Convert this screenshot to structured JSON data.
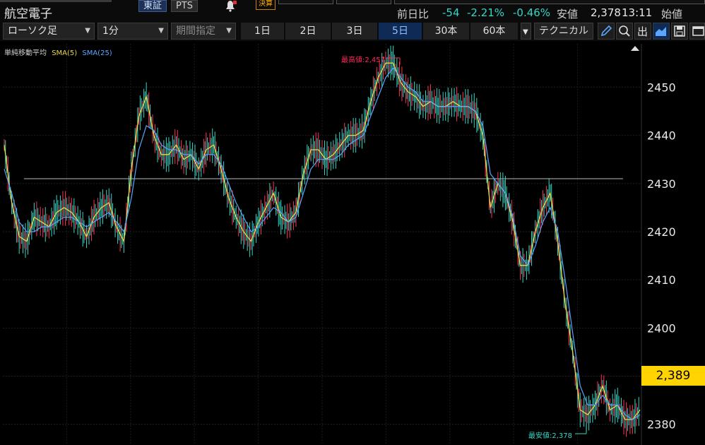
{
  "header": {
    "stock_name": "航空電子",
    "market_tabs": [
      "東証",
      "PTS"
    ],
    "kessan_badge": "決算",
    "prev_label": "前日比",
    "change": "-54",
    "change_pct": "-2.21%",
    "change_pct2": "-0.46%",
    "low_label": "安値",
    "low_value": "2,378",
    "time": "13:11",
    "open_label": "始値"
  },
  "toolbar": {
    "chart_type": "ローソク足",
    "interval": "1分",
    "period_select": "期間指定",
    "ranges": [
      "1日",
      "2日",
      "3日",
      "5日",
      "30本",
      "60本"
    ],
    "active_range": 3,
    "technical": "テクニカル",
    "output_label": "出",
    "colors": {
      "accent": "#0f2a55",
      "accent_text": "#8ec0ff"
    }
  },
  "chart_data": {
    "type": "line",
    "title": "",
    "legend": {
      "title": "単純移動平均",
      "series": [
        "SMA(5)",
        "SMA(25)"
      ]
    },
    "y_ticks": [
      2450,
      2440,
      2430,
      2420,
      2410,
      2400,
      2390,
      2380
    ],
    "y_tick_labels": [
      "2450",
      "2440",
      "2430",
      "2420",
      "2410",
      "2400",
      "2380"
    ],
    "ylim": [
      2376,
      2459
    ],
    "current_price": "2,389",
    "high_annotation": "最高値:2,457",
    "low_annotation": "最安値:2,378",
    "reference_line": 2431,
    "grid": true,
    "series": [
      {
        "name": "SMA(5)",
        "color": "#e8d84a",
        "values": [
          2438,
          2426,
          2419,
          2418,
          2423,
          2422,
          2421,
          2424,
          2425,
          2424,
          2422,
          2419,
          2423,
          2425,
          2426,
          2421,
          2418,
          2433,
          2444,
          2448,
          2440,
          2436,
          2436,
          2438,
          2435,
          2436,
          2433,
          2437,
          2438,
          2433,
          2427,
          2423,
          2420,
          2418,
          2422,
          2425,
          2428,
          2423,
          2422,
          2424,
          2432,
          2437,
          2437,
          2435,
          2436,
          2438,
          2440,
          2440,
          2441,
          2447,
          2452,
          2455,
          2455,
          2451,
          2449,
          2448,
          2446,
          2447,
          2446,
          2446,
          2447,
          2446,
          2446,
          2445,
          2440,
          2425,
          2430,
          2428,
          2422,
          2413,
          2413,
          2420,
          2425,
          2428,
          2418,
          2405,
          2395,
          2383,
          2382,
          2384,
          2388,
          2383,
          2384,
          2381,
          2381,
          2383
        ]
      },
      {
        "name": "SMA(25)",
        "color": "#5aa5ff",
        "values": [
          2433,
          2428,
          2422,
          2420,
          2420,
          2421,
          2421,
          2422,
          2423,
          2423,
          2422,
          2421,
          2422,
          2423,
          2424,
          2422,
          2420,
          2427,
          2437,
          2442,
          2441,
          2438,
          2437,
          2437,
          2436,
          2436,
          2434,
          2436,
          2436,
          2434,
          2430,
          2426,
          2423,
          2420,
          2421,
          2423,
          2425,
          2424,
          2422,
          2423,
          2428,
          2433,
          2435,
          2435,
          2435,
          2436,
          2438,
          2439,
          2440,
          2444,
          2448,
          2452,
          2454,
          2452,
          2450,
          2449,
          2447,
          2447,
          2446,
          2446,
          2446,
          2446,
          2446,
          2445,
          2442,
          2432,
          2430,
          2428,
          2423,
          2415,
          2413,
          2417,
          2422,
          2425,
          2420,
          2410,
          2399,
          2388,
          2384,
          2384,
          2386,
          2384,
          2384,
          2382,
          2381,
          2382
        ]
      }
    ]
  }
}
